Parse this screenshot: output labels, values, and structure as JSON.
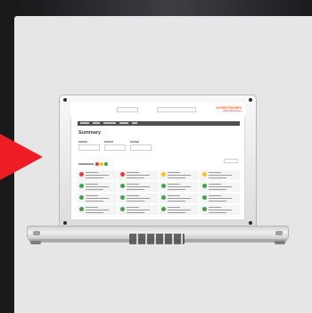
{
  "scene": {
    "background_color": "#e6e6e6",
    "arrow_color": "#ee1c24"
  },
  "laptop_screen": {
    "page_title": "Summary",
    "brand": {
      "name": "KONECRANES",
      "tagline": "Lifting Businesses",
      "name_color": "#f26b21",
      "tagline_color": "#ee1c24"
    },
    "nav_item_count": 6,
    "filter_count": 3,
    "legend_colors": [
      "#e53935",
      "#f5c518",
      "#43a047"
    ],
    "cards": [
      {
        "status": "red"
      },
      {
        "status": "red"
      },
      {
        "status": "yellow"
      },
      {
        "status": "yellow"
      },
      {
        "status": "green"
      },
      {
        "status": "green"
      },
      {
        "status": "green"
      },
      {
        "status": "green"
      },
      {
        "status": "green"
      },
      {
        "status": "green"
      },
      {
        "status": "green"
      },
      {
        "status": "green"
      },
      {
        "status": "green"
      },
      {
        "status": "green"
      },
      {
        "status": "green"
      },
      {
        "status": "green"
      }
    ],
    "status_colors": {
      "red": "#e53935",
      "yellow": "#f5c518",
      "green": "#43a047"
    }
  }
}
